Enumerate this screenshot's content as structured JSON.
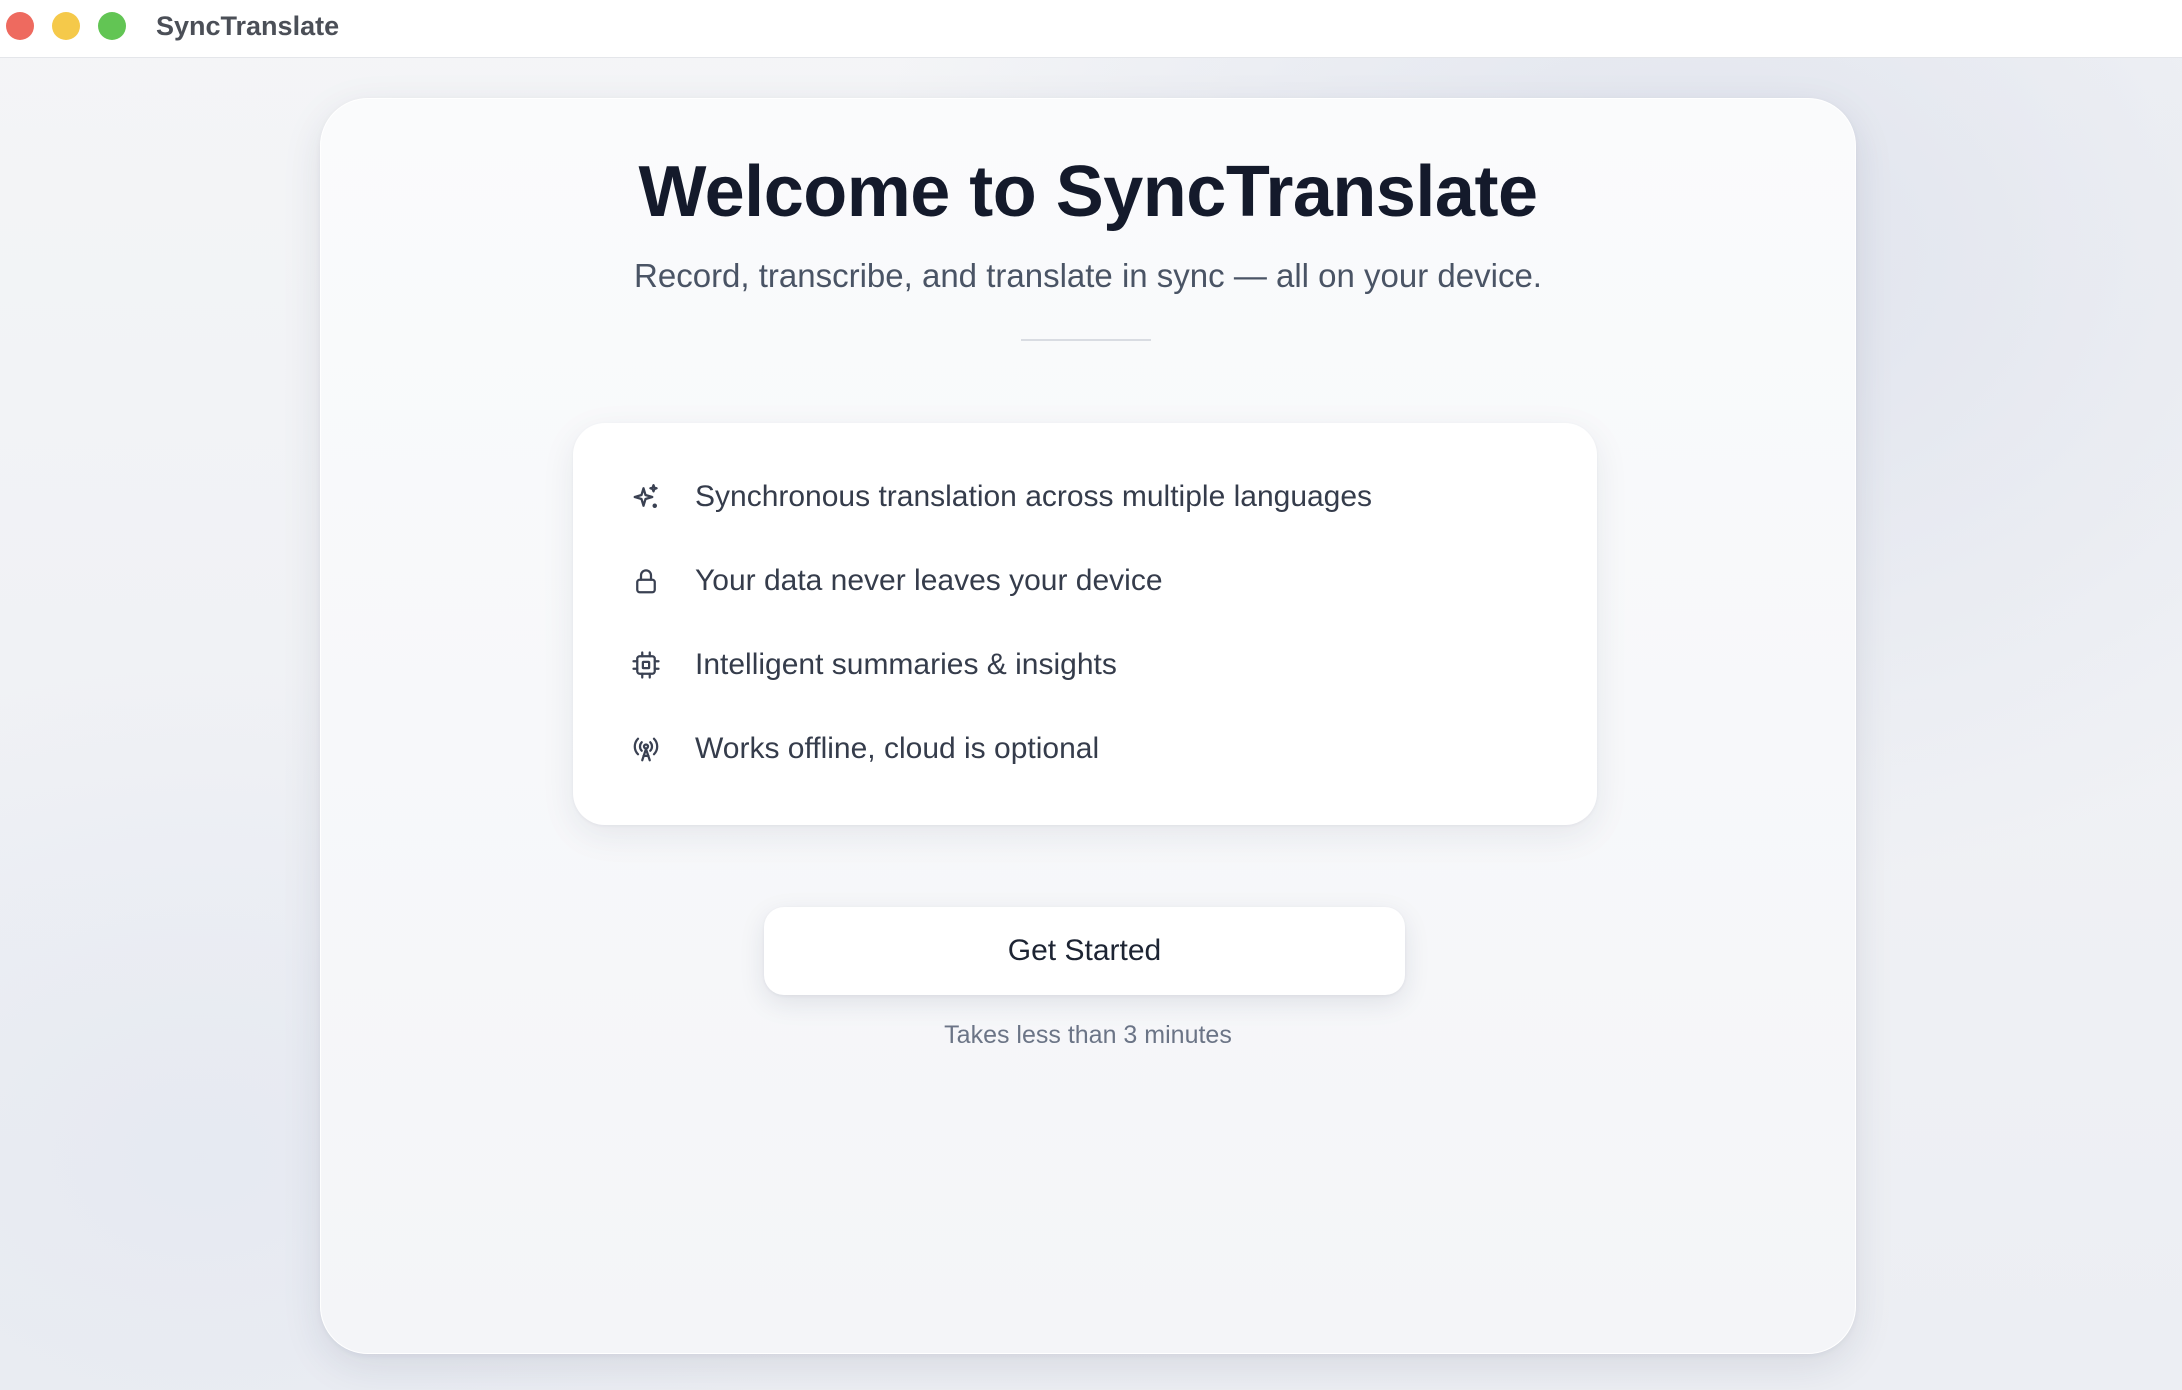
{
  "window": {
    "title": "SyncTranslate"
  },
  "welcome": {
    "heading": "Welcome to SyncTranslate",
    "subtitle": "Record, transcribe, and translate in sync — all on your device."
  },
  "features": [
    {
      "icon": "sparkles-icon",
      "label": "Synchronous translation across multiple languages"
    },
    {
      "icon": "lock-icon",
      "label": "Your data never leaves your device"
    },
    {
      "icon": "cpu-chip-icon",
      "label": "Intelligent summaries & insights"
    },
    {
      "icon": "broadcast-antenna-icon",
      "label": "Works offline, cloud is optional"
    }
  ],
  "cta": {
    "label": "Get Started",
    "hint": "Takes less than 3 minutes"
  },
  "colors": {
    "traffic_close": "#ee6a5f",
    "traffic_minimize": "#f5c94a",
    "traffic_maximize": "#62c554",
    "heading": "#141a2b",
    "text": "#353c4b"
  }
}
